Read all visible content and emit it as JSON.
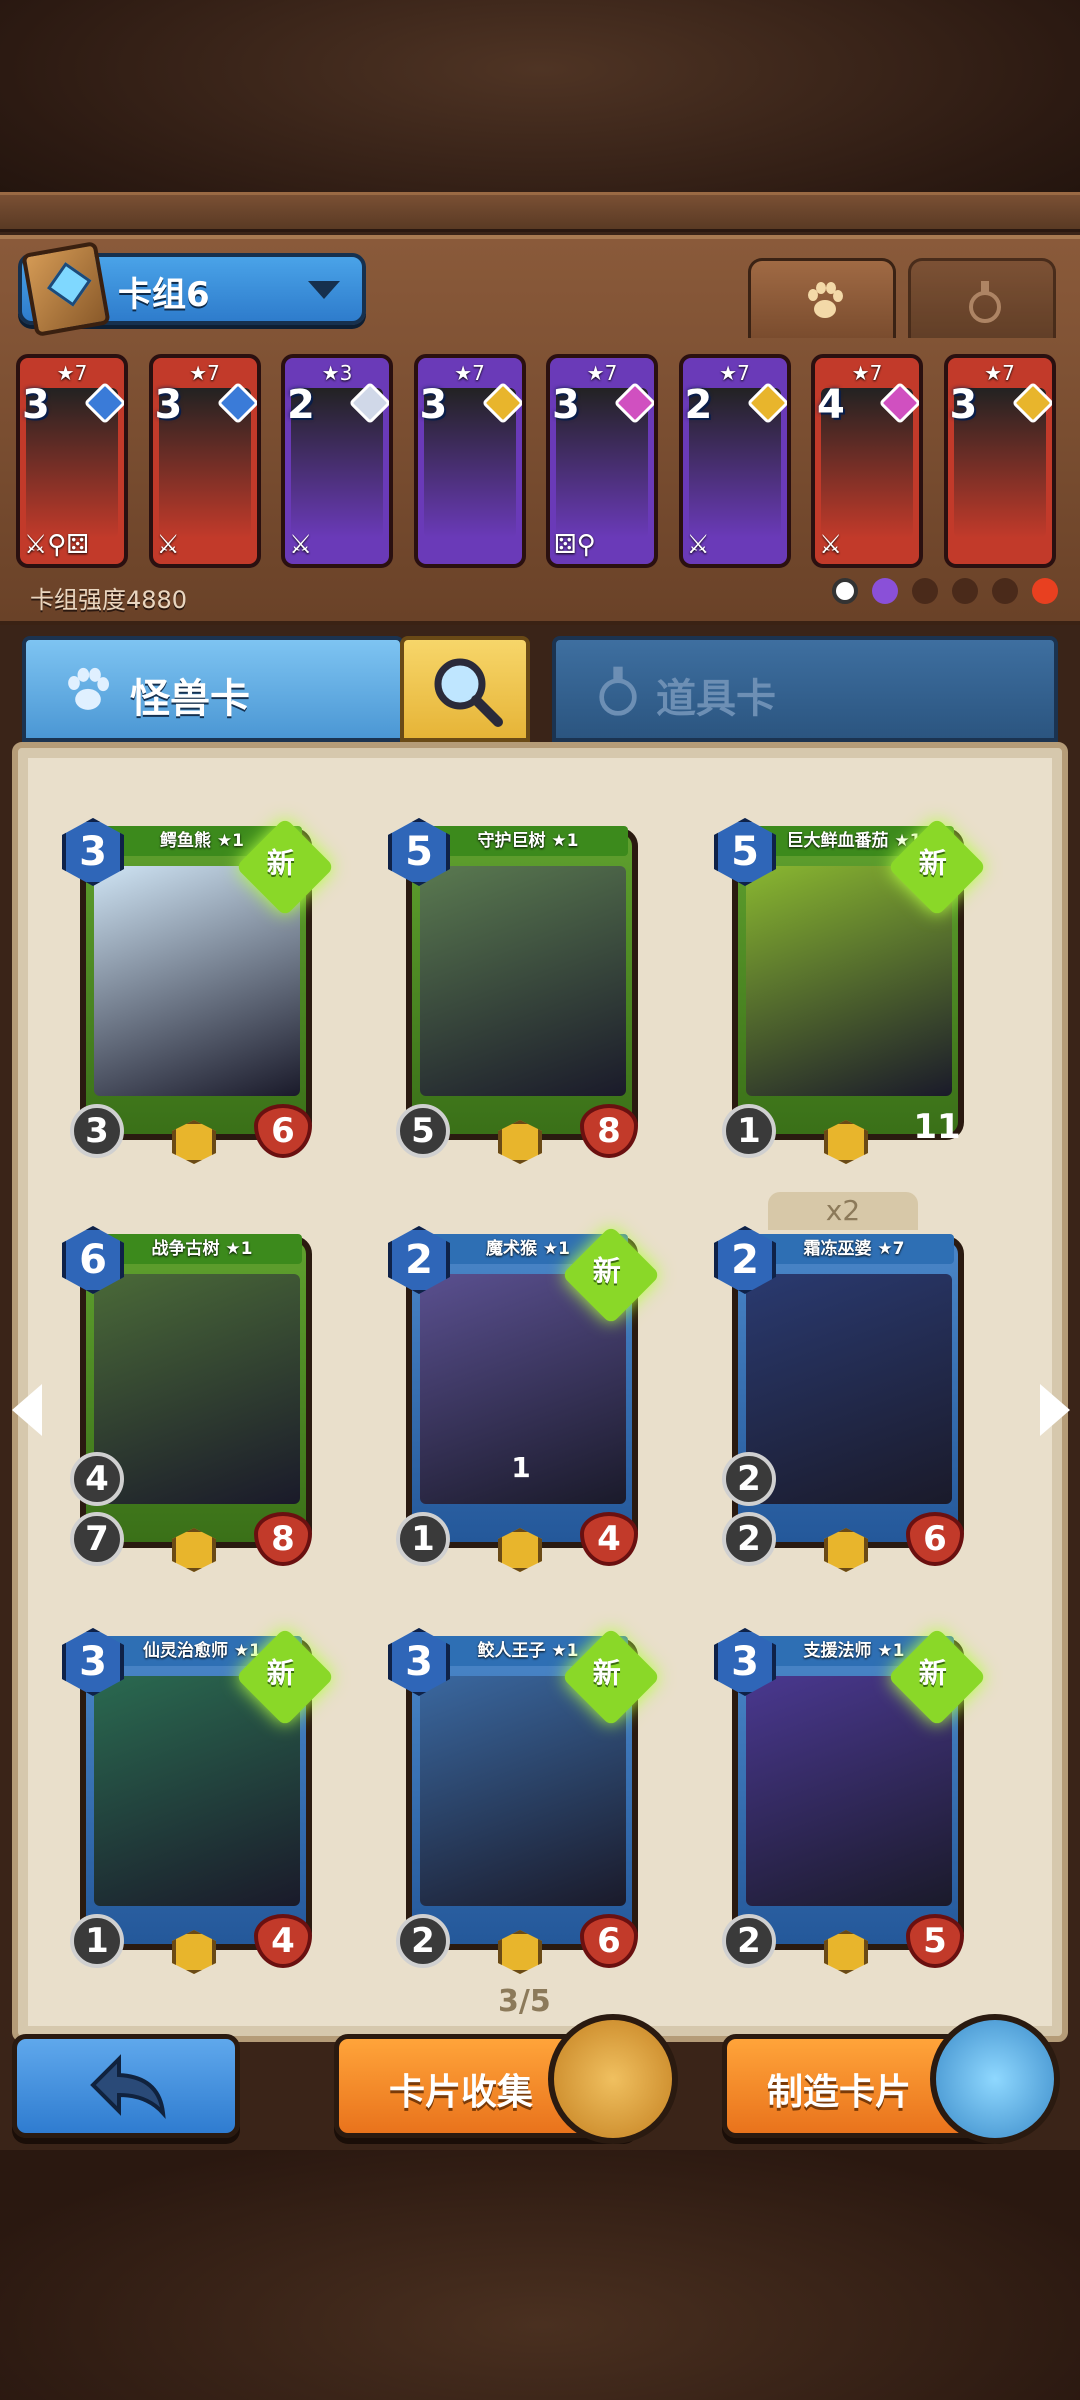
{
  "deck": {
    "name": "卡组6",
    "strength_text": "卡组强度4880",
    "mini_cards": [
      {
        "stars": "★7",
        "cost": "3",
        "tools": "⚔⚲⚄",
        "border": "#c23a2a",
        "gem": "#3a7bd8"
      },
      {
        "stars": "★7",
        "cost": "3",
        "tools": "⚔",
        "border": "#c23a2a",
        "gem": "#3a7bd8"
      },
      {
        "stars": "★3",
        "cost": "2",
        "tools": "⚔",
        "border": "#6a3ab8",
        "gem": "#d0d8e8"
      },
      {
        "stars": "★7",
        "cost": "3",
        "tools": "",
        "border": "#6a3ab8",
        "gem": "#e8b52c"
      },
      {
        "stars": "★7",
        "cost": "3",
        "tools": "⚄⚲",
        "border": "#6a3ab8",
        "gem": "#d050c0"
      },
      {
        "stars": "★7",
        "cost": "2",
        "tools": "⚔",
        "border": "#6a3ab8",
        "gem": "#e8b52c"
      },
      {
        "stars": "★7",
        "cost": "4",
        "tools": "⚔",
        "border": "#c23a2a",
        "gem": "#d050c0"
      },
      {
        "stars": "★7",
        "cost": "3",
        "tools": "",
        "border": "#c23a2a",
        "gem": "#e8b52c"
      }
    ]
  },
  "tabs": {
    "monster_label": "怪兽卡",
    "item_label": "道具卡"
  },
  "cards": [
    {
      "name": "鳄鱼熊 ★1",
      "cost": "3",
      "atk": "3",
      "hp": "6",
      "new": "新",
      "color": "green",
      "art": "#cfe4f4"
    },
    {
      "name": "守护巨树 ★1",
      "cost": "5",
      "atk": "5",
      "hp": "8",
      "new": "",
      "color": "green",
      "art": "#5a7a50"
    },
    {
      "name": "巨大鲜血番茄 ★1",
      "cost": "5",
      "atk": "1",
      "hp": "11",
      "new": "新",
      "color": "green",
      "art": "#8ab830"
    },
    {
      "name": "战争古树 ★1",
      "cost": "6",
      "atk": "7",
      "hp": "8",
      "buff": "4",
      "new": "",
      "color": "green",
      "art": "#4a6a38"
    },
    {
      "name": "魔术猴 ★1",
      "cost": "2",
      "atk": "1",
      "hp": "4",
      "ability": "1",
      "new": "新",
      "color": "blue",
      "art": "#5a5090"
    },
    {
      "name": "霜冻巫婆 ★7",
      "cost": "2",
      "atk": "2",
      "hp": "6",
      "buff": "2",
      "count": "x2",
      "new": "",
      "color": "blue",
      "art": "#2a3a70"
    },
    {
      "name": "仙灵治愈师 ★1",
      "cost": "3",
      "atk": "1",
      "hp": "4",
      "new": "新",
      "color": "blue",
      "art": "#2a6a50"
    },
    {
      "name": "鲛人王子 ★1",
      "cost": "3",
      "atk": "2",
      "hp": "6",
      "new": "新",
      "color": "blue",
      "art": "#3a68a0"
    },
    {
      "name": "支援法师 ★1",
      "cost": "3",
      "atk": "2",
      "hp": "5",
      "new": "新",
      "color": "blue",
      "art": "#4a3890"
    }
  ],
  "pagination": "3/5",
  "buttons": {
    "collect_label": "卡片收集",
    "craft_label": "制造卡片"
  },
  "icons": {
    "deck_book": "deck-book-icon",
    "monster_tab": "paw-icon",
    "item_tab": "potion-icon",
    "search": "magnifier-icon",
    "back": "back-arrow-icon"
  }
}
